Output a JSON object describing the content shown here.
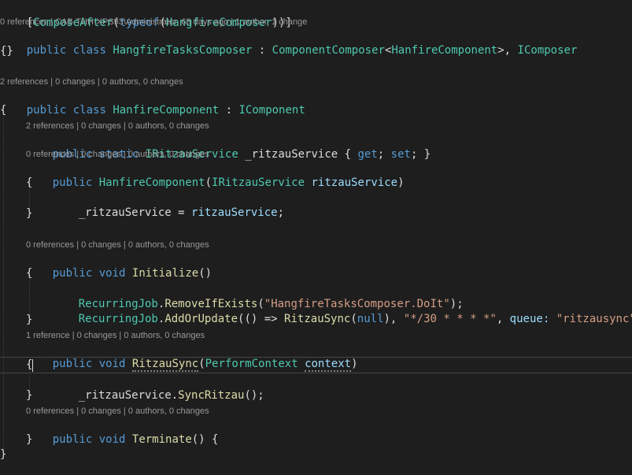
{
  "editor": {
    "lines": {
      "l1": [
        "[",
        "ComposeAfter",
        "(",
        "typeof",
        "(",
        "HangfireComposer",
        "))]"
      ],
      "lens1": "0 references | CAB-THH-XPS93\\Administrator, 68 days ago | 1 author, 1 change",
      "l2": [
        "public",
        " ",
        "class",
        " ",
        "HangfireTasksComposer",
        " : ",
        "ComponentComposer",
        "<",
        "HanfireComponent",
        ">, ",
        "IComposer"
      ],
      "l3": "{}",
      "lens2": "2 references | 0 changes | 0 authors, 0 changes",
      "l4": [
        "public",
        " ",
        "class",
        " ",
        "HanfireComponent",
        " : ",
        "IComponent"
      ],
      "l5": "{",
      "lens3": "2 references | 0 changes | 0 authors, 0 changes",
      "l6": [
        "public",
        " ",
        "static",
        " ",
        "IRitzauService",
        " _ritzauService { ",
        "get",
        "; ",
        "set",
        "; }"
      ],
      "lens4": "0 references | 0 changes | 0 authors, 0 changes",
      "l7": [
        "public",
        " ",
        "HanfireComponent",
        "(",
        "IRitzauService",
        " ",
        "ritzauService",
        ")"
      ],
      "l8": "{",
      "l9": [
        "_ritzauService = ",
        "ritzauService",
        ";"
      ],
      "l10": "}",
      "lens5": "0 references | 0 changes | 0 authors, 0 changes",
      "l11": [
        "public",
        " ",
        "void",
        " ",
        "Initialize",
        "()"
      ],
      "l12": "{",
      "l13": [
        "RecurringJob",
        ".",
        "RemoveIfExists",
        "(",
        "\"HangfireTasksComposer.DoIt\"",
        ");"
      ],
      "l14": [
        "RecurringJob",
        ".",
        "AddOrUpdate",
        "(() => ",
        "RitzauSync",
        "(",
        "null",
        "), ",
        "\"*/30 * * * *\"",
        ", ",
        "queue:",
        " ",
        "\"ritzausync\"",
        ");"
      ],
      "l15": "}",
      "lens6": "1 reference | 0 changes | 0 authors, 0 changes",
      "l16": [
        "public",
        " ",
        "void",
        " ",
        "RitzauSync",
        "(",
        "PerformContext",
        " ",
        "context",
        ")"
      ],
      "l17": "{",
      "l18": [
        "_ritzauService.",
        "SyncRitzau",
        "();"
      ],
      "l19": "}",
      "lens7": "0 references | 0 changes | 0 authors, 0 changes",
      "l20": [
        "public",
        " ",
        "void",
        " ",
        "Terminate",
        "() {"
      ],
      "l21": "}",
      "l22": "}"
    }
  }
}
